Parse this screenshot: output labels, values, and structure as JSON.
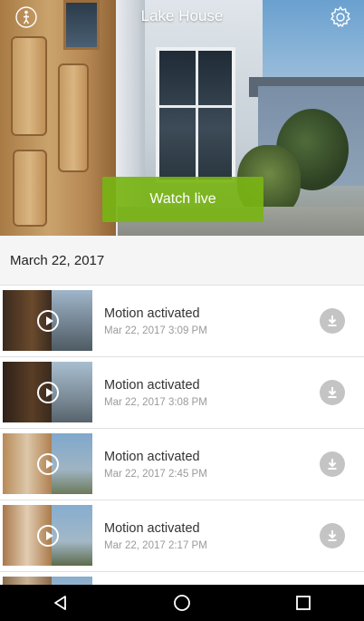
{
  "header": {
    "title": "Lake House",
    "left_icon": "person-standing-icon",
    "right_icon": "gear-icon"
  },
  "hero": {
    "watch_live_label": "Watch live",
    "accent_color": "#78b414"
  },
  "date_section": {
    "label": "March 22, 2017"
  },
  "events": [
    {
      "title": "Motion activated",
      "time": "Mar 22, 2017 3:09 PM",
      "icon": "play-icon",
      "action_icon": "download-icon"
    },
    {
      "title": "Motion activated",
      "time": "Mar 22, 2017 3:08 PM",
      "icon": "play-icon",
      "action_icon": "download-icon"
    },
    {
      "title": "Motion activated",
      "time": "Mar 22, 2017 2:45 PM",
      "icon": "play-icon",
      "action_icon": "download-icon"
    },
    {
      "title": "Motion activated",
      "time": "Mar 22, 2017 2:17 PM",
      "icon": "play-icon",
      "action_icon": "download-icon"
    }
  ],
  "navbar": {
    "back_icon": "back-triangle-icon",
    "home_icon": "home-circle-icon",
    "recents_icon": "recents-square-icon"
  }
}
